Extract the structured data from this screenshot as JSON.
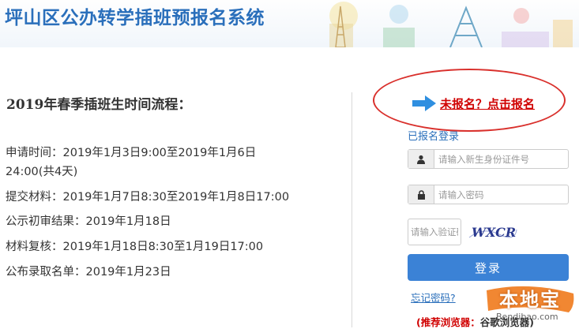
{
  "header": {
    "title": "坪山区公办转学插班预报名系统"
  },
  "schedule": {
    "title": "2019年春季插班生时间流程：",
    "lines": [
      "申请时间：2019年1月3日9:00至2019年1月6日",
      "24:00(共4天)",
      "提交材料：2019年1月7日8:30至2019年1月8日17:00",
      "公示初审结果：2019年1月18日",
      "材料复核：2019年1月18日8:30至1月19日17:00",
      "公布录取名单：2019年1月23日"
    ]
  },
  "login": {
    "register_link": "未报名？点击报名",
    "registered_link": "已报名登录",
    "id_placeholder": "请输入新生身份证件号",
    "password_placeholder": "请输入密码",
    "captcha_placeholder": "请输入验证码",
    "captcha_text": "WXCR",
    "login_button": "登录",
    "forgot_link": "忘记密码?",
    "browser_note_label": "(推荐浏览器：",
    "browser_note_value": "谷歌浏览器)"
  },
  "watermark": {
    "text": "本地宝",
    "url": "Bendibao.com"
  },
  "colors": {
    "title_blue": "#2a6fbb",
    "button_blue": "#3b82d6",
    "alert_red": "#d00000",
    "circle_red": "#d9302c"
  },
  "icons": {
    "id_field": "user-icon",
    "password_field": "lock-icon",
    "register": "arrow-right-icon"
  }
}
